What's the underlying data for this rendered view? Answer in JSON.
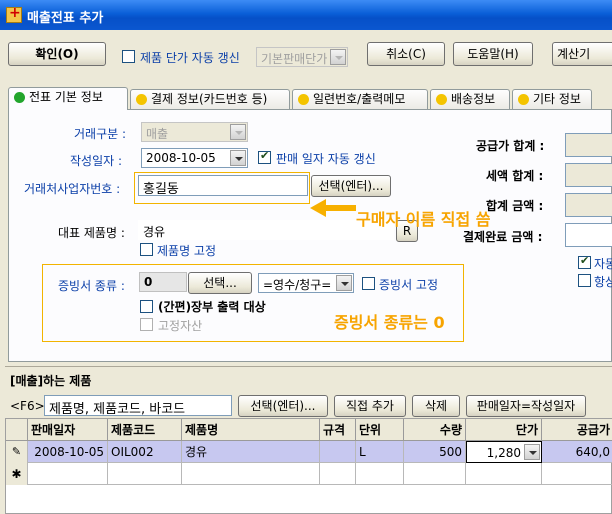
{
  "window": {
    "title": "매출전표 추가"
  },
  "toolbar": {
    "confirm": "확인(O)",
    "auto_price_label": "제품 단가 자동 갱신",
    "price_select": "기본판매단가",
    "cancel": "취소(C)",
    "help": "도움말(H)",
    "calc": "계산기"
  },
  "tabs": [
    {
      "label": "전표 기본 정보",
      "color": "#22a52c"
    },
    {
      "label": "결제 정보(카드번호 등)",
      "color": "#f4c400"
    },
    {
      "label": "일련번호/출력메모",
      "color": "#f4c400"
    },
    {
      "label": "배송정보",
      "color": "#f4c400"
    },
    {
      "label": "기타 정보",
      "color": "#f4c400"
    }
  ],
  "form": {
    "trade_type_label": "거래구분 :",
    "trade_type_value": "매출",
    "date_label": "작성일자 :",
    "date_value": "2008-10-05",
    "auto_date_label": "판매 일자 자동 갱신",
    "partner_label": "거래처사업자번호 :",
    "partner_value": "홍길동",
    "select_enter": "선택(엔터)...",
    "product_label": "대표 제품명 :",
    "product_value": "경유",
    "product_btn": "R",
    "product_fixed_label": "제품명 고정",
    "receipt_label": "증빙서 종류 :",
    "receipt_value": "0",
    "receipt_select_btn": "선택...",
    "receipt_combo": "=영수/청구=",
    "receipt_fixed_label": "증빙서 고정",
    "ledger_label": "(간편)장부 출력 대상",
    "fixed_asset_label": "고정자산"
  },
  "totals": {
    "supply_total": "공급가 합계 :",
    "tax_total": "세액 합계 :",
    "total_amount": "합계 금액 :",
    "unpaid": "결제완료 금액 :",
    "right_check_1": "자동",
    "right_check_2": "항상"
  },
  "annotations": {
    "buyer_note": "구매자 이름 직접 씀",
    "receipt_note": "증빙서 종류는 0"
  },
  "products": {
    "section_label": "[매출]하는 제품",
    "f6_label": "<F6>",
    "search_placeholder": "제품명, 제품코드, 바코드",
    "select_btn": "선택(엔터)...",
    "direct_add": "직접 추가",
    "delete": "삭제",
    "date_equal": "판매일자=작성일자",
    "columns": [
      "판매일자",
      "제품코드",
      "제품명",
      "규격",
      "단위",
      "수량",
      "단가",
      "공급가"
    ],
    "rows": [
      {
        "date": "2008-10-05",
        "code": "OIL002",
        "name": "경유",
        "spec": "",
        "unit": "L",
        "qty": "500",
        "price": "1,280",
        "supply": "640,0"
      }
    ],
    "new_row_marker": "✱",
    "edit_marker": "✎"
  }
}
